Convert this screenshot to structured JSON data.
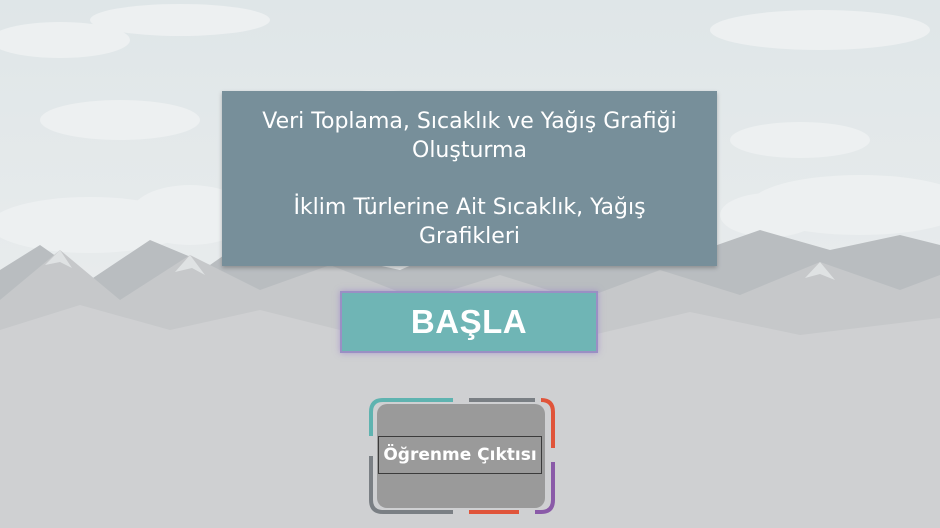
{
  "title": {
    "line1": "Veri Toplama, Sıcaklık ve Yağış Grafiği",
    "line2": "Oluşturma",
    "line3": "İklim Türlerine Ait Sıcaklık, Yağış",
    "line4": "Grafikleri"
  },
  "start_button": {
    "label": "BAŞLA"
  },
  "outcome_button": {
    "label": "Öğrenme Çıktısı"
  },
  "colors": {
    "title_box": "#778f9a",
    "start_button": "#6fb5b5",
    "frame_teal": "#5fb3b0",
    "frame_red": "#e0543a",
    "frame_purple": "#8a5aa8"
  }
}
